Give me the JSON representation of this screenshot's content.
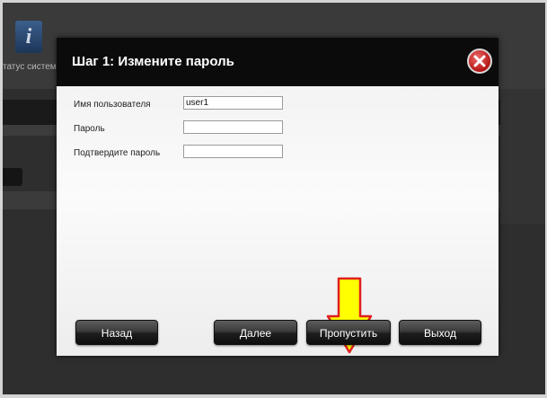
{
  "background": {
    "toolbar": {
      "system_status_label": "татус системы"
    }
  },
  "dialog": {
    "title": "Шаг 1: Измените пароль",
    "fields": {
      "username": {
        "label": "Имя пользователя",
        "value": "user1"
      },
      "password": {
        "label": "Пароль",
        "value": ""
      },
      "confirm_password": {
        "label": "Подтвердите пароль",
        "value": ""
      }
    },
    "buttons": {
      "back": "Назад",
      "next": "Далее",
      "skip": "Пропустить",
      "exit": "Выход"
    }
  },
  "icons": {
    "close": "close-icon",
    "info": "info-icon",
    "pointer": "arrow-down-icon"
  },
  "colors": {
    "header_bg": "#0b0b0b",
    "close_red": "#b31414",
    "arrow_yellow": "#ffff00",
    "arrow_outline": "#e02020"
  }
}
